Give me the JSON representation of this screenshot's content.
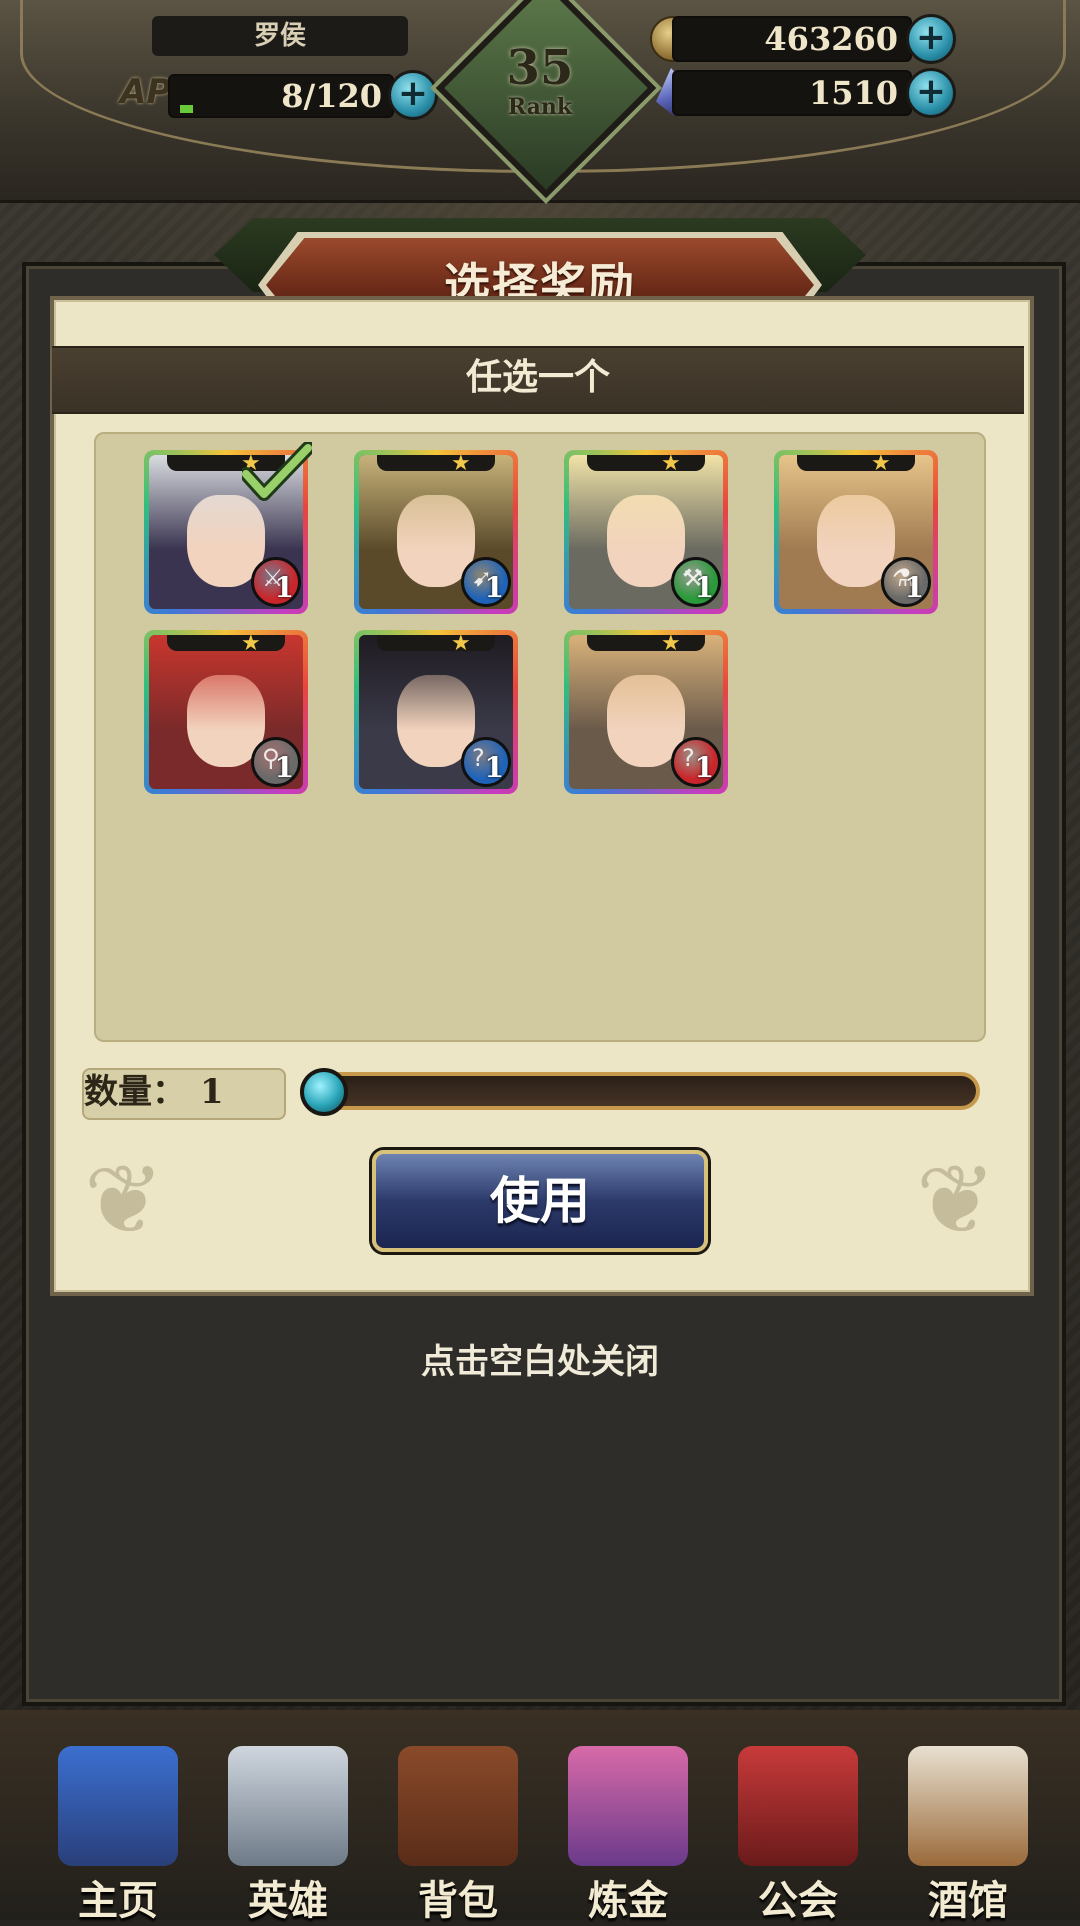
{
  "hud": {
    "player_name": "罗侯",
    "ap_label": "AP",
    "ap_value": "8/120",
    "ap_fill_fraction": 0.067,
    "rank_number": "35",
    "rank_label": "Rank",
    "gold": "463260",
    "gems": "1510",
    "plus_symbol": "+"
  },
  "modal": {
    "title": "选择奖励",
    "subtitle": "任选一个",
    "rewards": [
      {
        "name_icon": "hero-pirate-portrait-icon",
        "stars": "★",
        "level": "1",
        "class_icon": "sword-class-icon",
        "badge_color": "#c9262b",
        "selected": true
      },
      {
        "name_icon": "hero-vampire-portrait-icon",
        "stars": "★",
        "level": "1",
        "class_icon": "bow-class-icon",
        "badge_color": "#1f63b8",
        "selected": false
      },
      {
        "name_icon": "hero-blonde-girl-portrait-icon",
        "stars": "★",
        "level": "1",
        "class_icon": "axe-class-icon",
        "badge_color": "#2a9a3a",
        "selected": false
      },
      {
        "name_icon": "hero-elf-girl-portrait-icon",
        "stars": "★",
        "level": "1",
        "class_icon": "staff-class-icon",
        "badge_color": "#6a6a6a",
        "selected": false
      },
      {
        "name_icon": "hero-redhead-portrait-icon",
        "stars": "★",
        "level": "1",
        "class_icon": "mage-class-icon",
        "badge_color": "#6a6a6a",
        "selected": false
      },
      {
        "name_icon": "hero-dark-hair-portrait-icon",
        "stars": "★",
        "level": "1",
        "class_icon": "hook-class-icon",
        "badge_color": "#1f63b8",
        "selected": false
      },
      {
        "name_icon": "hero-masked-girl-portrait-icon",
        "stars": "★",
        "level": "1",
        "class_icon": "hook-class-icon",
        "badge_color": "#c9262b",
        "selected": false
      }
    ],
    "quantity_label": "数量：",
    "quantity_value": "1",
    "use_button": "使用",
    "close_hint": "点击空白处关闭"
  },
  "nav": {
    "items": [
      {
        "label": "主页",
        "icon": "castle-icon"
      },
      {
        "label": "英雄",
        "icon": "winged-helmet-icon"
      },
      {
        "label": "背包",
        "icon": "backpack-icon"
      },
      {
        "label": "炼金",
        "icon": "potion-flask-icon"
      },
      {
        "label": "公会",
        "icon": "guild-shield-icon"
      },
      {
        "label": "酒馆",
        "icon": "tavern-mug-icon"
      }
    ]
  },
  "colors": {
    "parchment": "#ece6c7",
    "title_banner": "#7a3320",
    "use_button": "#2c3a6a",
    "slider_knob": "#2aa6b8"
  }
}
